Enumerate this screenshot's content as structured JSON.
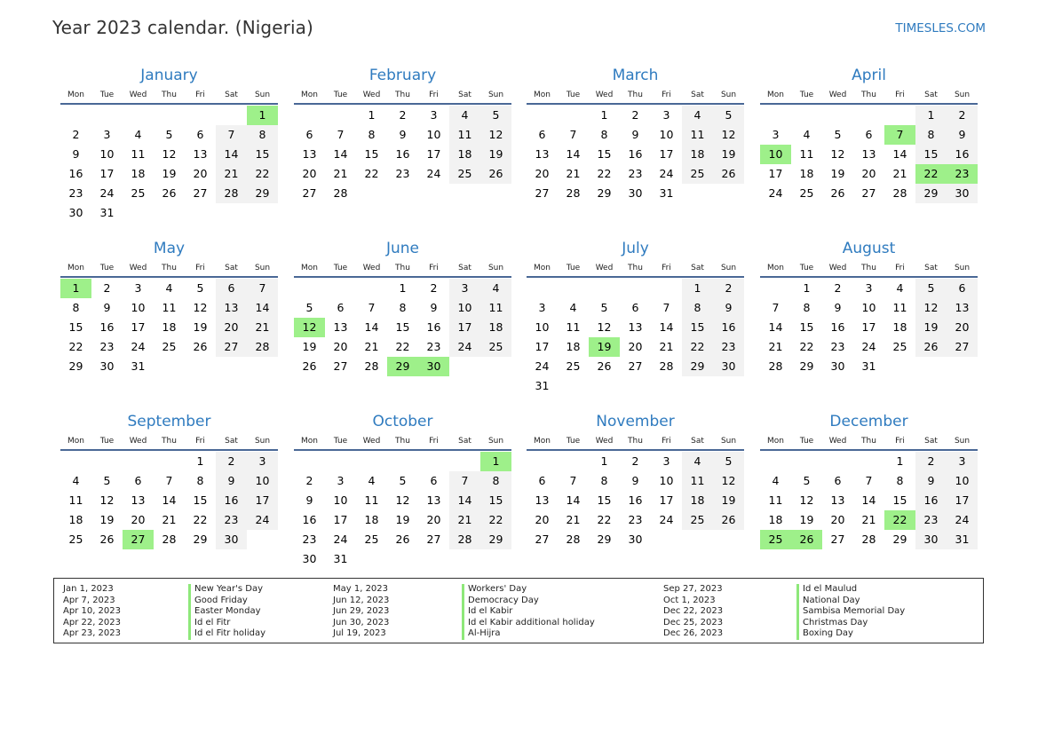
{
  "header": {
    "title": "Year 2023 calendar. (Nigeria)",
    "brand": "TIMESLES.COM"
  },
  "weekdays": [
    "Mon",
    "Tue",
    "Wed",
    "Thu",
    "Fri",
    "Sat",
    "Sun"
  ],
  "colors": {
    "accent": "#2f7bbf",
    "holiday": "#9ef08a",
    "weekend": "#f2f2f2",
    "rule": "#4a6896"
  },
  "months": [
    {
      "name": "January",
      "offset": 6,
      "days": 31,
      "holidays": [
        1
      ]
    },
    {
      "name": "February",
      "offset": 2,
      "days": 28,
      "holidays": []
    },
    {
      "name": "March",
      "offset": 2,
      "days": 31,
      "holidays": []
    },
    {
      "name": "April",
      "offset": 5,
      "days": 30,
      "holidays": [
        7,
        10,
        22,
        23
      ]
    },
    {
      "name": "May",
      "offset": 0,
      "days": 31,
      "holidays": [
        1
      ]
    },
    {
      "name": "June",
      "offset": 3,
      "days": 30,
      "holidays": [
        12,
        29,
        30
      ]
    },
    {
      "name": "July",
      "offset": 5,
      "days": 31,
      "holidays": [
        19
      ]
    },
    {
      "name": "August",
      "offset": 1,
      "days": 31,
      "holidays": []
    },
    {
      "name": "September",
      "offset": 4,
      "days": 30,
      "holidays": [
        27
      ]
    },
    {
      "name": "October",
      "offset": 6,
      "days": 31,
      "holidays": [
        1
      ]
    },
    {
      "name": "November",
      "offset": 2,
      "days": 30,
      "holidays": []
    },
    {
      "name": "December",
      "offset": 4,
      "days": 31,
      "holidays": [
        22,
        25,
        26
      ]
    }
  ],
  "holiday_list": [
    {
      "date": "Jan 1, 2023",
      "name": "New Year's Day"
    },
    {
      "date": "Apr 7, 2023",
      "name": "Good Friday"
    },
    {
      "date": "Apr 10, 2023",
      "name": "Easter Monday"
    },
    {
      "date": "Apr 22, 2023",
      "name": "Id el Fitr"
    },
    {
      "date": "Apr 23, 2023",
      "name": "Id el Fitr holiday"
    },
    {
      "date": "May 1, 2023",
      "name": "Workers' Day"
    },
    {
      "date": "Jun 12, 2023",
      "name": "Democracy Day"
    },
    {
      "date": "Jun 29, 2023",
      "name": "Id el Kabir"
    },
    {
      "date": "Jun 30, 2023",
      "name": "Id el Kabir additional holiday"
    },
    {
      "date": "Jul 19, 2023",
      "name": "Al-Hijra"
    },
    {
      "date": "Sep 27, 2023",
      "name": "Id el Maulud"
    },
    {
      "date": "Oct 1, 2023",
      "name": "National Day"
    },
    {
      "date": "Dec 22, 2023",
      "name": "Sambisa Memorial Day"
    },
    {
      "date": "Dec 25, 2023",
      "name": "Christmas Day"
    },
    {
      "date": "Dec 26, 2023",
      "name": "Boxing Day"
    }
  ]
}
